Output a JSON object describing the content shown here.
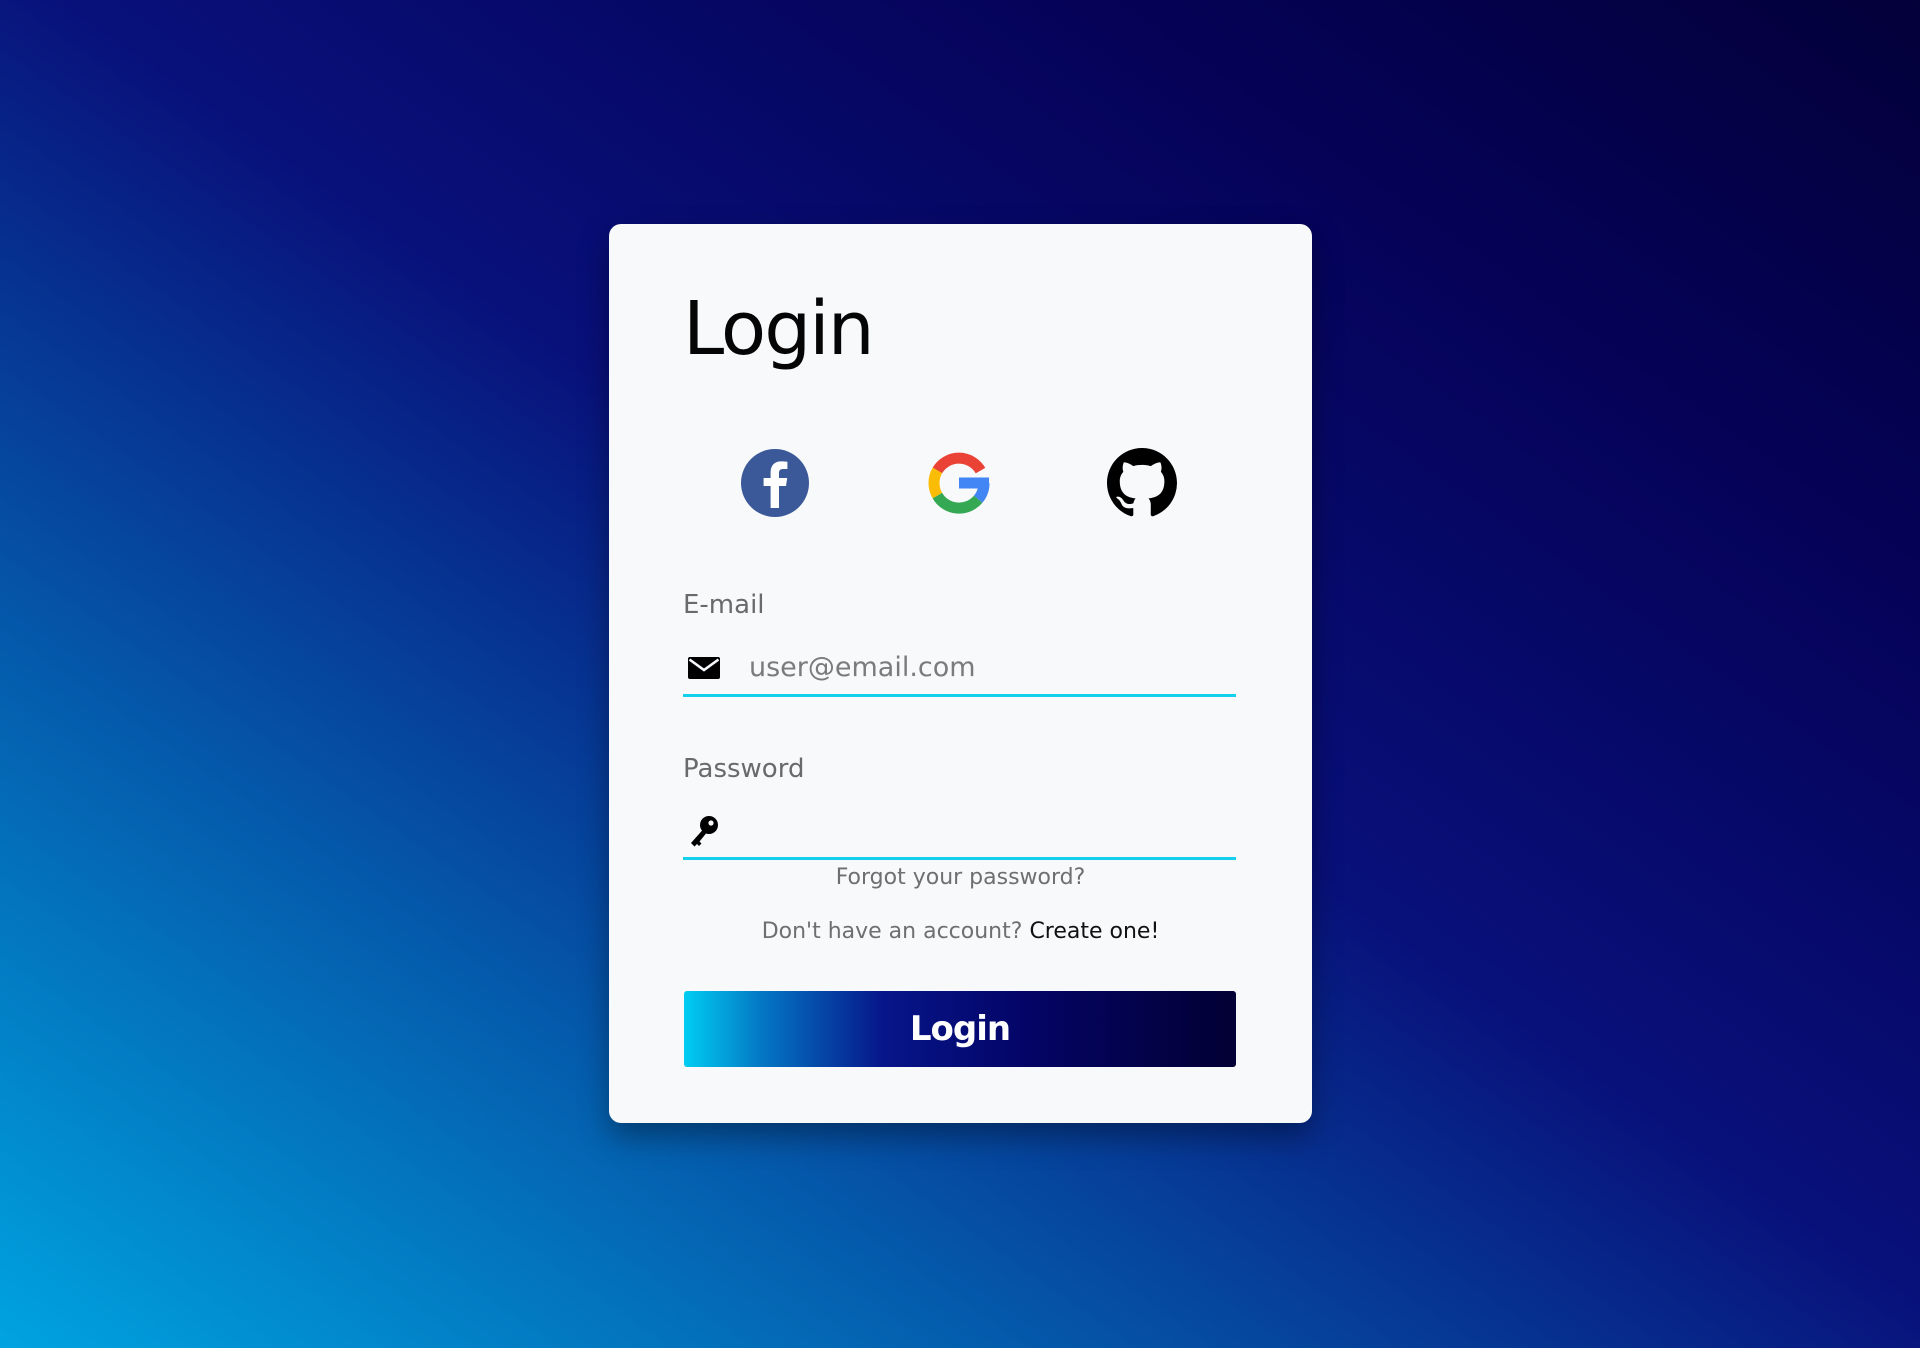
{
  "login_card": {
    "title": "Login",
    "social": [
      {
        "name": "facebook",
        "icon": "facebook-icon",
        "color": "#3b5998"
      },
      {
        "name": "google",
        "icon": "google-icon",
        "colors": [
          "#4285F4",
          "#EA4335",
          "#FBBC05",
          "#34A853"
        ]
      },
      {
        "name": "github",
        "icon": "github-icon",
        "color": "#000000"
      }
    ],
    "email": {
      "label": "E-mail",
      "icon": "envelope-icon",
      "placeholder": "user@email.com",
      "value": ""
    },
    "password": {
      "label": "Password",
      "icon": "key-icon",
      "value": ""
    },
    "forgot_link": "Forgot your password?",
    "signup_prompt": "Don't have an account?",
    "signup_link": "Create one!",
    "submit_label": "Login"
  },
  "colors": {
    "accent_underline": "#14d0ec",
    "card_background": "#f7f9fb",
    "button_gradient_start": "#00cdf2",
    "button_gradient_end": "#020033"
  }
}
